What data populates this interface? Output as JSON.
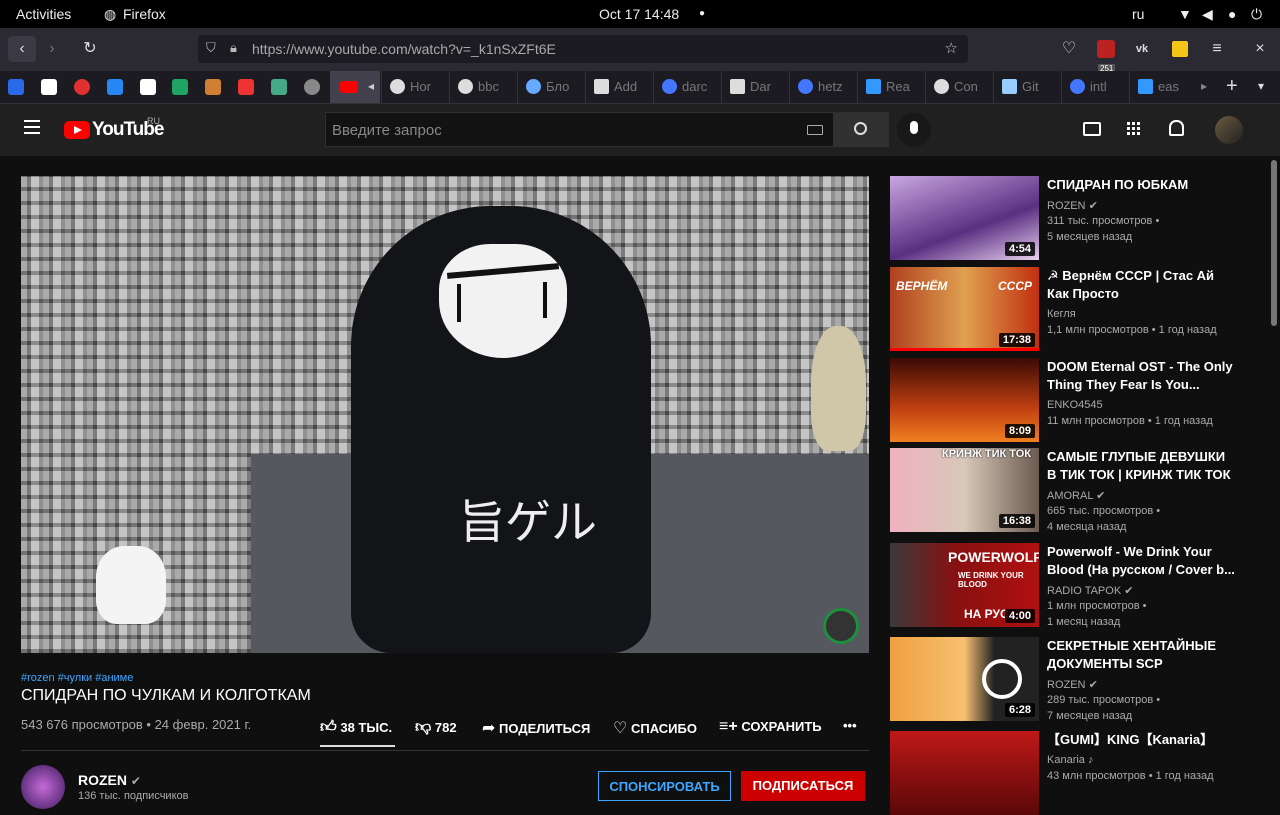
{
  "system": {
    "activities": "Activities",
    "app": "Firefox",
    "datetime": "Oct 17  14:48",
    "lang": "ru"
  },
  "browser": {
    "url": "https://www.youtube.com/watch?v=_k1nSxZFt6E",
    "badge": "251"
  },
  "tabs": [
    "Hor",
    "bbc",
    "Бло",
    "Add",
    "darc",
    "Dar",
    "hetz",
    "Rea",
    "Con",
    "Git",
    "intl",
    "eas"
  ],
  "youtube": {
    "logo": "YouTube",
    "region": "RU",
    "search_placeholder": "Введите запрос"
  },
  "video": {
    "tags": "#rozen #чулки #аниме",
    "title": "СПИДРАН ПО ЧУЛКАМ И КОЛГОТКАМ",
    "views_date": "543 676 просмотров • 24 февр. 2021 г.",
    "likes": "38 ТЫС.",
    "dislikes": "782",
    "share": "ПОДЕЛИТЬСЯ",
    "thanks": "СПАСИБО",
    "save": "СОХРАНИТЬ",
    "shirt_text": "旨ゲル"
  },
  "channel": {
    "name": "ROZEN",
    "subs": "136 тыс. подписчиков",
    "sponsor": "СПОНСИРОВАТЬ",
    "subscribe": "ПОДПИСАТЬСЯ"
  },
  "related": [
    {
      "title": "СПИДРАН ПО ЮБКАМ",
      "channel": "ROZEN",
      "views": "311 тыс. просмотров •",
      "age": "5 месяцев назад",
      "duration": "4:54",
      "color": "#b490c8"
    },
    {
      "title": "☭ Вернём СССР | Стас Ай Как Просто",
      "channel": "Кегля",
      "views": "1,1 млн просмотров • 1 год назад",
      "age": "",
      "duration": "17:38",
      "color": "#c04a22",
      "thumb_l": "ВЕРНЁМ",
      "thumb_r": "СССР"
    },
    {
      "title": "DOOM Eternal OST - The Only Thing They Fear Is You...",
      "channel": "ENKO4545",
      "views": "11 млн просмотров • 1 год назад",
      "age": "",
      "duration": "8:09",
      "color": "#8a2a10"
    },
    {
      "title": "САМЫЕ ГЛУПЫЕ ДЕВУШКИ В ТИК ТОК | КРИНЖ ТИК ТОК",
      "channel": "AMORAL",
      "views": "665 тыс. просмотров •",
      "age": "4 месяца назад",
      "duration": "16:38",
      "color": "#e8a0b0",
      "thumb_t": "КРИНЖ ТИК ТОК"
    },
    {
      "title": "Powerwolf - We Drink Your Blood (На русском / Cover b...",
      "channel": "RADIO TAPOK",
      "views": "1 млн просмотров •",
      "age": "1 месяц назад",
      "duration": "4:00",
      "color": "#7a1010",
      "thumb_t": "POWERWOLF",
      "thumb_s": "WE DRINK YOUR BLOOD",
      "thumb_b": "НА РУС"
    },
    {
      "title": "СЕКРЕТНЫЕ ХЕНТАЙНЫЕ ДОКУМЕНТЫ SCP",
      "channel": "ROZEN",
      "views": "289 тыс. просмотров •",
      "age": "7 месяцев назад",
      "duration": "6:28",
      "color": "#f0a040"
    },
    {
      "title": "【GUMI】KING【Kanaria】",
      "channel": "Kanaria ♪",
      "views": "43 млн просмотров • 1 год назад",
      "age": "",
      "duration": "",
      "color": "#b01818"
    }
  ]
}
